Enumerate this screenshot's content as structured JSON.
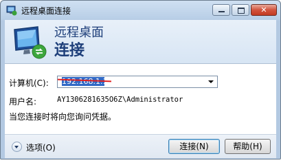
{
  "window": {
    "title": "远程桌面连接"
  },
  "header": {
    "line1": "远程桌面",
    "line2": "连接"
  },
  "form": {
    "computer_label": "计算机(C):",
    "computer_value": "192.168.1.10",
    "user_label": "用户名:",
    "user_value": "AY1306281635O6Z\\Administrator",
    "note": "当您连接时将向您询问凭据。"
  },
  "footer": {
    "options_label": "选项(O)",
    "connect_label": "连接(N)",
    "help_label": "帮助(H)"
  },
  "colors": {
    "accent": "#3169c6",
    "title_blue": "#1e3f7a",
    "redaction": "#e02020"
  }
}
